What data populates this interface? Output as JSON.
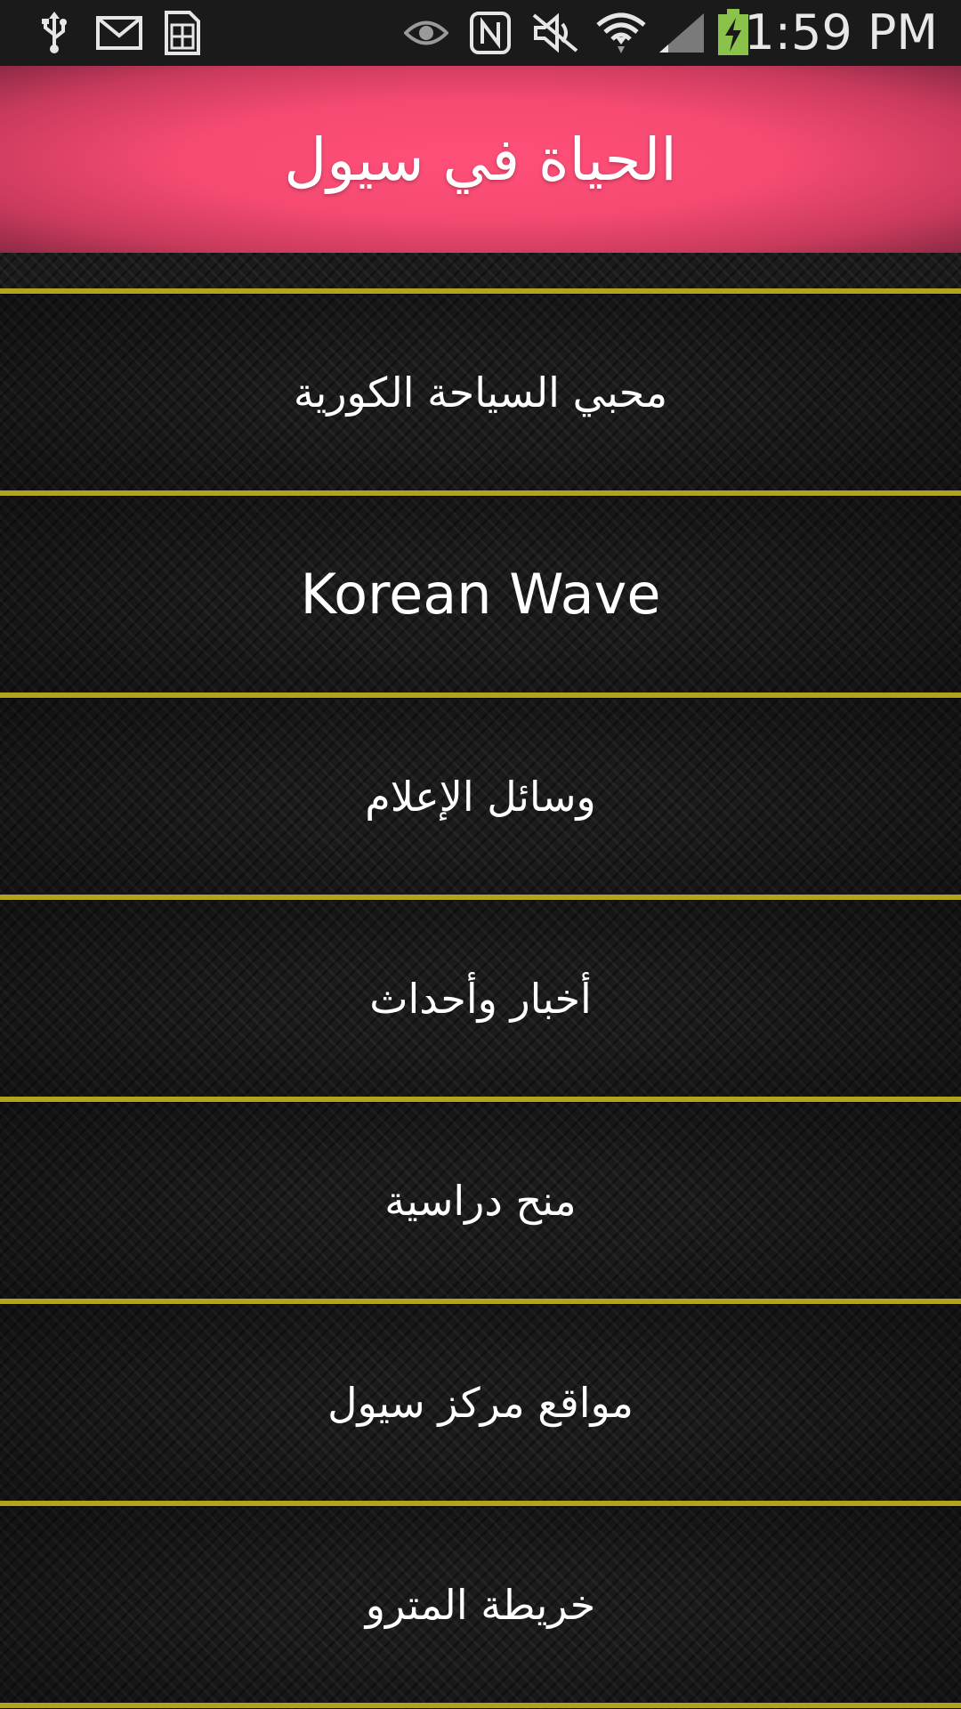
{
  "status_bar": {
    "time": "1:59 PM",
    "left_icons": [
      "usb-icon",
      "gmail-icon",
      "sim-card-icon"
    ],
    "right_icons": [
      "eye-icon",
      "nfc-icon",
      "mute-icon",
      "wifi-icon",
      "signal-icon",
      "battery-charging-icon"
    ]
  },
  "header": {
    "title": "الحياة في سيول",
    "color": "#f54a72"
  },
  "menu": {
    "divider_color": "#b0a51a",
    "items": [
      {
        "label": "محبي السياحة الكورية"
      },
      {
        "label": "Korean Wave"
      },
      {
        "label": "وسائل الإعلام"
      },
      {
        "label": "أخبار وأحداث"
      },
      {
        "label": "منح دراسية"
      },
      {
        "label": "مواقع مركز سيول"
      },
      {
        "label": "خريطة المترو"
      }
    ]
  }
}
